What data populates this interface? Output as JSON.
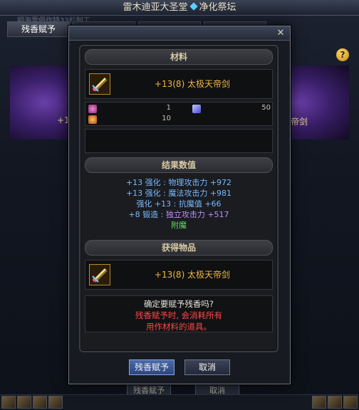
{
  "window": {
    "title_left": "雷木迪亚大圣堂",
    "title_right": "净化祭坛",
    "subtitle": "明海雷倡作特33杉制工",
    "tabs": [
      {
        "label": "残香赋予",
        "active": true
      },
      {
        "label": "",
        "active": false
      },
      {
        "label": "",
        "active": false
      },
      {
        "label": "",
        "active": false
      }
    ],
    "help": "?",
    "banner_left_text": "+13(",
    "banner_right_text": "帝剑",
    "bottom_buttons": {
      "confirm": "残香赋予",
      "cancel": "取消"
    }
  },
  "dialog": {
    "close_glyph": "✕",
    "materials": {
      "header": "材料",
      "item_name": "+13(8) 太极天帝剑",
      "mats": [
        {
          "icon": "pink-crystal-icon",
          "qty": "1",
          "color": "#c84aa8"
        },
        {
          "icon": "blue-shard-icon",
          "qty": "50",
          "color": "#7a7aff"
        },
        {
          "icon": "orange-fragment-icon",
          "qty": "10",
          "color": "#e07a2a"
        }
      ]
    },
    "results": {
      "header": "结果数值",
      "lines": [
        [
          {
            "t": "+13 强化 : 物理攻击力 +972",
            "c": "c-blue"
          }
        ],
        [
          {
            "t": "+13 强化 : 魔法攻击力 +981",
            "c": "c-blue"
          }
        ],
        [
          {
            "t": "强化 +13 : 抗魔值 +66",
            "c": "c-blue"
          }
        ],
        [
          {
            "t": "+8 锻造 : ",
            "c": "c-blue"
          },
          {
            "t": "独立攻击力 +517",
            "c": "c-purple"
          }
        ],
        [
          {
            "t": "附魔",
            "c": "c-green"
          }
        ]
      ]
    },
    "obtained": {
      "header": "获得物品",
      "item_name": "+13(8) 太极天帝剑"
    },
    "confirm": {
      "question": "确定要赋予残香吗?",
      "warning_1": "残香赋予时, 会消耗所有",
      "warning_2": "用作材料的道具。"
    },
    "buttons": {
      "confirm": "残香赋予",
      "cancel": "取消"
    }
  }
}
